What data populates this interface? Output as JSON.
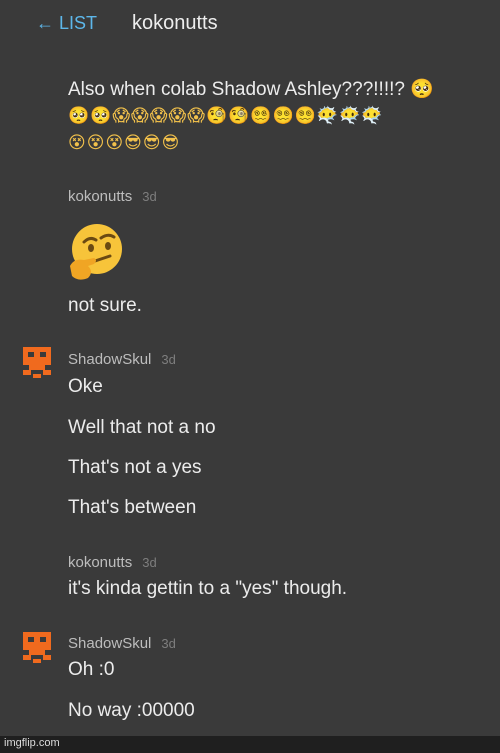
{
  "header": {
    "back_label": "← LIST",
    "title": "kokonutts"
  },
  "messages": [
    {
      "lines": [
        "Also when colab Shadow Ashley???!!!!? 🥺"
      ],
      "emoji_rows": [
        "🥺🥺😱😱😱😱😱🧐🧐😵‍💫😵‍💫😵‍💫😶‍🌫️😶‍🌫️😶‍🌫️",
        "😵😵😵😎😎😎"
      ]
    },
    {
      "author": "kokonutts",
      "time": "3d",
      "image_icon": "thinking-face-icon",
      "lines": [
        "not sure."
      ]
    },
    {
      "author": "ShadowSkul",
      "time": "3d",
      "avatar_icon": "shadowskul-avatar",
      "lines": [
        "Oke",
        "Well that not a no",
        "That's not a yes",
        "That's between"
      ]
    },
    {
      "author": "kokonutts",
      "time": "3d",
      "lines": [
        "it's kinda gettin to a \"yes\" though."
      ]
    },
    {
      "author": "ShadowSkul",
      "time": "3d",
      "avatar_icon": "shadowskul-avatar",
      "lines": [
        "Oh :0",
        "No way :00000"
      ]
    }
  ],
  "footer": {
    "watermark": "imgflip.com"
  },
  "colors": {
    "background": "#3a3a3a",
    "link": "#5db7ea",
    "avatar": "#f06a1e"
  }
}
